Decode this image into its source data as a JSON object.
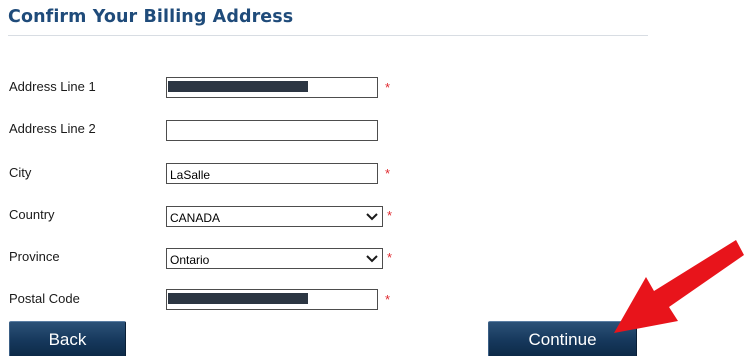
{
  "page": {
    "title": "Confirm Your Billing Address"
  },
  "form": {
    "address_line_1": {
      "label": "Address Line 1",
      "value": "",
      "redacted": true,
      "required": "*"
    },
    "address_line_2": {
      "label": "Address Line 2",
      "value": "",
      "required": ""
    },
    "city": {
      "label": "City",
      "value": "LaSalle",
      "required": "*"
    },
    "country": {
      "label": "Country",
      "selected": "CANADA",
      "required": "*"
    },
    "province": {
      "label": "Province",
      "selected": "Ontario",
      "required": "*"
    },
    "postal_code": {
      "label": "Postal Code",
      "value": "",
      "redacted": true,
      "required": "*"
    }
  },
  "buttons": {
    "back_label": "Back",
    "continue_label": "Continue"
  },
  "annotation": {
    "arrow_color": "#e8141b",
    "points_to": "continue-button"
  },
  "colors": {
    "title": "#1f4b7a",
    "button_bg": "#16385c",
    "required": "#e0292f"
  }
}
